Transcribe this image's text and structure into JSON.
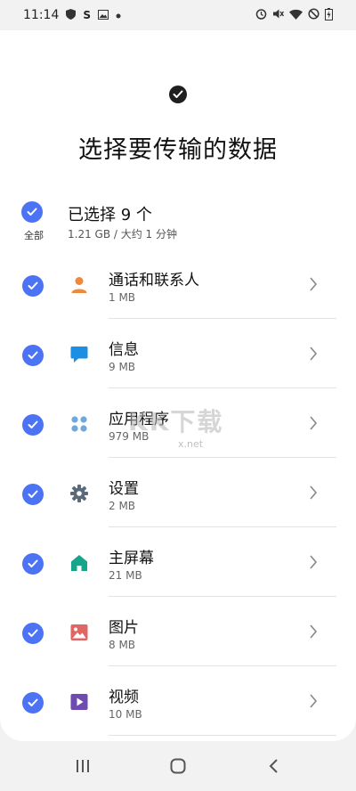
{
  "status_bar": {
    "time": "11:14",
    "left_icons": [
      "shield-icon",
      "s-app-icon",
      "image-icon",
      "dot-icon"
    ],
    "right_icons": [
      "alarm-icon",
      "mute-icon",
      "wifi-icon",
      "no-disturb-icon",
      "battery-icon"
    ]
  },
  "header": {
    "title": "选择要传输的数据"
  },
  "select_all": {
    "label": "全部",
    "title": "已选择 9 个",
    "subtitle": "1.21 GB / 大约 1 分钟"
  },
  "items": [
    {
      "name": "通话和联系人",
      "size": "1 MB",
      "icon": "contact-person-icon",
      "color": "#f0883a"
    },
    {
      "name": "信息",
      "size": "9 MB",
      "icon": "message-icon",
      "color": "#1a8fe3"
    },
    {
      "name": "应用程序",
      "size": "979 MB",
      "icon": "apps-icon",
      "color": "#6fa8dc"
    },
    {
      "name": "设置",
      "size": "2 MB",
      "icon": "settings-gear-icon",
      "color": "#5a6a7a"
    },
    {
      "name": "主屏幕",
      "size": "21 MB",
      "icon": "home-icon",
      "color": "#17a589"
    },
    {
      "name": "图片",
      "size": "8 MB",
      "icon": "picture-icon",
      "color": "#e06666"
    },
    {
      "name": "视频",
      "size": "10 MB",
      "icon": "video-icon",
      "color": "#6d4bb0"
    }
  ],
  "watermark": {
    "text": "KK下载",
    "sub": "x.net"
  },
  "colors": {
    "accent": "#4d73f5",
    "background": "#f2f2f2",
    "card": "#ffffff"
  }
}
